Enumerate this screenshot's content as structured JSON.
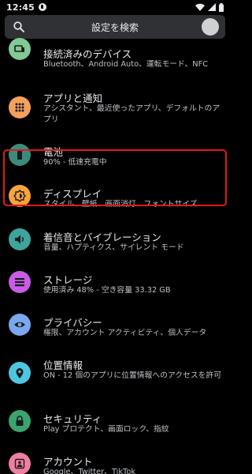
{
  "status_bar": {
    "time": "12:45"
  },
  "search": {
    "placeholder": "設定を検索"
  },
  "items": [
    {
      "id": "connected-devices",
      "title": "接続済みのデバイス",
      "subtitle": "Bluetooth、Android Auto、運転モード、NFC",
      "icon": "devices-icon",
      "color": "#81c995"
    },
    {
      "id": "apps-notifications",
      "title": "アプリと通知",
      "subtitle": "アシスタント、最近使ったアプリ、デフォルトのアプリ",
      "icon": "apps-icon",
      "color": "#f6a05c"
    },
    {
      "id": "battery",
      "title": "電池",
      "subtitle": "90% - 低速充電中",
      "icon": "battery-icon",
      "color": "#3c8c7c"
    },
    {
      "id": "display",
      "title": "ディスプレイ",
      "subtitle": "スタイル、壁紙、画面消灯、フォントサイズ",
      "icon": "brightness-icon",
      "color": "#f8a43c"
    },
    {
      "id": "sound",
      "title": "着信音とバイブレーション",
      "subtitle": "音量、ハプティクス、サイレント モード",
      "icon": "volume-icon",
      "color": "#3fa49b"
    },
    {
      "id": "storage",
      "title": "ストレージ",
      "subtitle": "使用済み 48% - 空き容量 33.32 GB",
      "icon": "storage-icon",
      "color": "#c95ce6"
    },
    {
      "id": "privacy",
      "title": "プライバシー",
      "subtitle": "権限、アカウント アクティビティ、個人データ",
      "icon": "privacy-icon",
      "color": "#7aa7f0"
    },
    {
      "id": "location",
      "title": "位置情報",
      "subtitle": "ON - 12 個のアプリに位置情報へのアクセスを許可",
      "icon": "location-icon",
      "color": "#4ec6e0"
    },
    {
      "id": "security",
      "title": "セキュリティ",
      "subtitle": "Play プロテクト、画面ロック、指紋",
      "icon": "lock-icon",
      "color": "#3ba370"
    },
    {
      "id": "accounts",
      "title": "アカウント",
      "subtitle": "Google、Twitter、TikTok",
      "icon": "account-icon",
      "color": "#ef7ea0"
    }
  ]
}
